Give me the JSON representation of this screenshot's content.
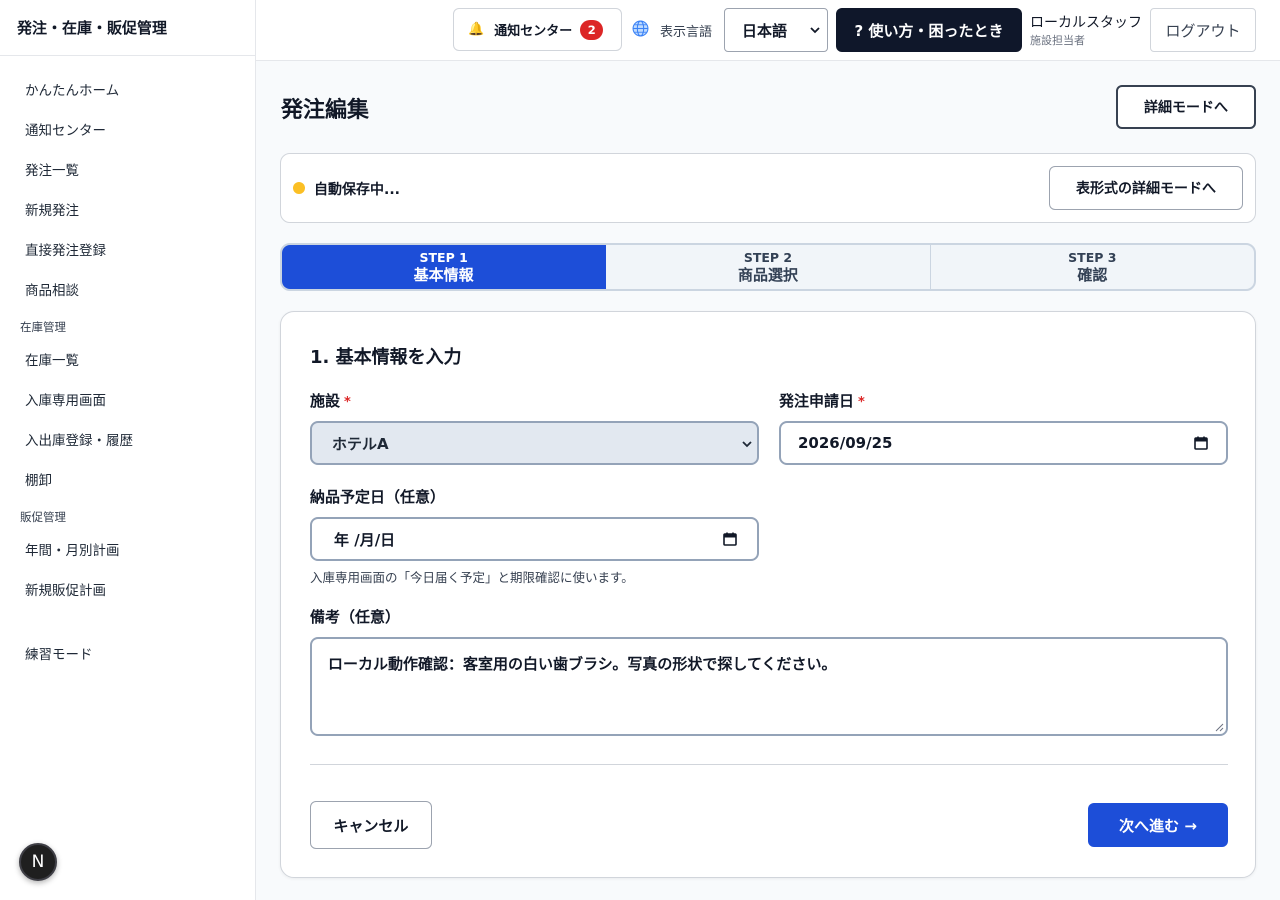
{
  "app": {
    "brand": "発注・在庫・販促管理"
  },
  "sidebar": {
    "items": [
      {
        "label": "かんたんホーム"
      },
      {
        "label": "通知センター"
      },
      {
        "label": "発注一覧"
      },
      {
        "label": "新規発注"
      },
      {
        "label": "直接発注登録"
      },
      {
        "label": "商品相談"
      }
    ],
    "inventory_section": "在庫管理",
    "inventory_items": [
      {
        "label": "在庫一覧"
      },
      {
        "label": "入庫専用画面"
      },
      {
        "label": "入出庫登録・履歴"
      },
      {
        "label": "棚卸"
      }
    ],
    "promo_section": "販促管理",
    "promo_items": [
      {
        "label": "年間・月別計画"
      },
      {
        "label": "新規販促計画"
      }
    ],
    "practice_item": "練習モード",
    "next_badge": "N"
  },
  "header": {
    "notify_label": "通知センター",
    "notify_count": "2",
    "lang_label": "表示言語",
    "lang_value": "日本語",
    "help_label": "? 使い方・困ったとき",
    "user_name": "ローカルスタッフ",
    "user_role": "施設担当者",
    "logout_label": "ログアウト"
  },
  "main": {
    "title": "発注編集",
    "detail_mode_label": "詳細モードへ",
    "autosave_text": "自動保存中...",
    "table_mode_label": "表形式の詳細モードへ",
    "steps": [
      {
        "num": "STEP 1",
        "label": "基本情報"
      },
      {
        "num": "STEP 2",
        "label": "商品選択"
      },
      {
        "num": "STEP 3",
        "label": "確認"
      }
    ],
    "form": {
      "section_title": "1. 基本情報を入力",
      "facility_label": "施設",
      "facility_value": "ホテルA",
      "request_date_label": "発注申請日",
      "request_date_value": "2026/09/25",
      "delivery_date_label": "納品予定日（任意）",
      "delivery_date_value": "年 /月/日",
      "delivery_hint": "入庫専用画面の「今日届く予定」と期限確認に使います。",
      "notes_label": "備考（任意）",
      "notes_value": "ローカル動作確認：客室用の白い歯ブラシ。写真の形状で探してください。",
      "required_mark": "*",
      "cancel_label": "キャンセル",
      "next_label": "次へ進む →"
    }
  },
  "colors": {
    "primary": "#1d4ed8",
    "dark": "#0f172a",
    "badge": "#dc2626",
    "autosave_dot": "#fbbf24"
  }
}
